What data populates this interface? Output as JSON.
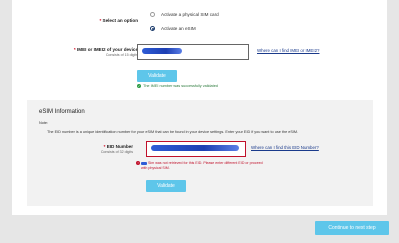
{
  "option": {
    "label": "Select an option",
    "required_marker": "* ",
    "choices": [
      {
        "label": "Activate a physical SIM card",
        "selected": false
      },
      {
        "label": "Activate an eSIM",
        "selected": true
      }
    ]
  },
  "imei": {
    "label": "IMEI or IMEI2 of your device",
    "required_marker": "* ",
    "hint": "Consists of 15 digits",
    "help_link": "Where can I find IMEI or IMEI2?",
    "validate_label": "Validate",
    "success_message": "The IMEI number was successfully validated"
  },
  "esim": {
    "title": "eSIM Information",
    "note_label": "Note:",
    "note_text": "The EID number is a unique identification number for your eSIM that can be found in your device settings. Enter your EID if you want to use the eSIM.",
    "eid_label": "EID Number",
    "required_marker": "* ",
    "eid_hint": "Consists of 32 digits",
    "help_link": "Where can I find this EID Number?",
    "error_message_line1": "Sim was not retrieved for this EID. Please enter different EID or proceed",
    "error_message_line2": "with physical SIM.",
    "validate_label": "Validate"
  },
  "footer": {
    "continue_label": "Continue to next step"
  },
  "colors": {
    "accent": "#5ec6ea",
    "error": "#c0102a",
    "success": "#2b7a3b",
    "link": "#1a3a8b"
  }
}
